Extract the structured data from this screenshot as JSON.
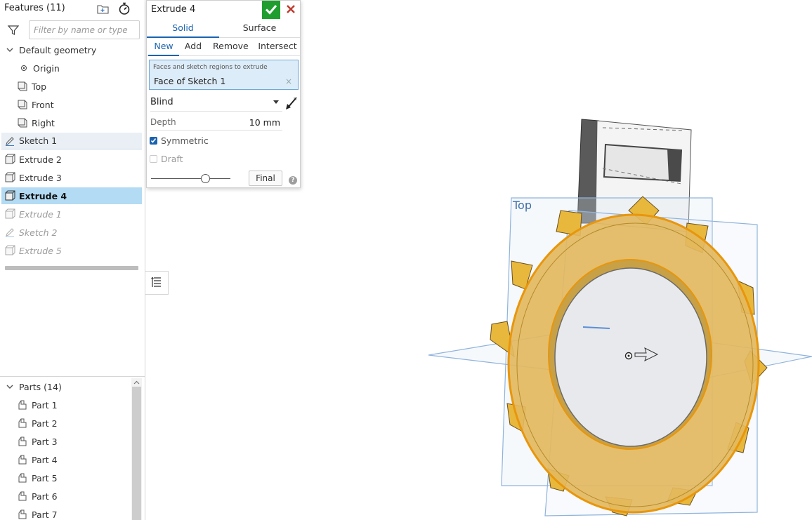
{
  "feature_tree": {
    "title": "Features (11)",
    "filter_placeholder": "Filter by name or type",
    "default_geometry": "Default geometry",
    "items": [
      {
        "label": "Origin"
      },
      {
        "label": "Top"
      },
      {
        "label": "Front"
      },
      {
        "label": "Right"
      },
      {
        "label": "Sketch 1"
      },
      {
        "label": "Extrude 2"
      },
      {
        "label": "Extrude 3"
      },
      {
        "label": "Extrude 4"
      },
      {
        "label": "Extrude 1"
      },
      {
        "label": "Sketch 2"
      },
      {
        "label": "Extrude 5"
      }
    ]
  },
  "parts": {
    "title": "Parts (14)",
    "items": [
      "Part 1",
      "Part 2",
      "Part 3",
      "Part 4",
      "Part 5",
      "Part 6",
      "Part 7"
    ]
  },
  "dialog": {
    "title": "Extrude 4",
    "type_tabs": [
      "Solid",
      "Surface"
    ],
    "active_type": "Solid",
    "op_tabs": [
      "New",
      "Add",
      "Remove",
      "Intersect"
    ],
    "active_op": "New",
    "selection_label": "Faces and sketch regions to extrude",
    "selection_value": "Face of Sketch 1",
    "selection_clear": "×",
    "end_type": "Blind",
    "depth_label": "Depth",
    "depth_value": "10 mm",
    "symmetric_label": "Symmetric",
    "symmetric_checked": true,
    "draft_label": "Draft",
    "draft_checked": false,
    "final_label": "Final",
    "help": "?"
  },
  "viewport": {
    "plane_label": "Top",
    "part_color": "#e3b95f",
    "edge_color": "#e8960c",
    "plane_color": "#8fb3dc"
  },
  "colors": {
    "accent": "#1a63b0",
    "ok_green": "#1f9e2f",
    "cancel_red": "#c0392b",
    "selected_row": "#b3dbf3"
  }
}
